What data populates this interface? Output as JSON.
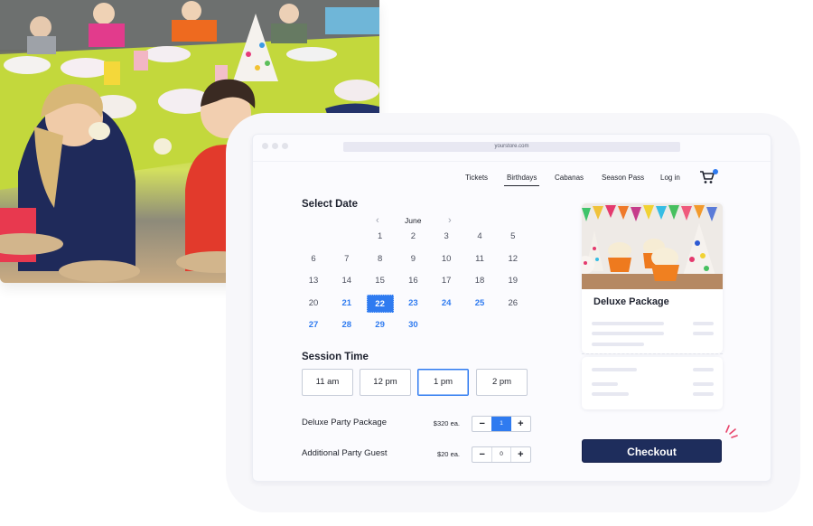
{
  "photo": {
    "alt": "children eating cupcakes at a birthday party table"
  },
  "browser": {
    "url": "yourstore.com",
    "nav": [
      {
        "label": "Tickets",
        "active": false
      },
      {
        "label": "Birthdays",
        "active": true
      },
      {
        "label": "Cabanas",
        "active": false
      },
      {
        "label": "Season Pass",
        "active": false
      },
      {
        "label": "Log in",
        "active": false
      }
    ],
    "cart_icon": "shopping-cart-icon",
    "cart_badge_color": "#2f7bf0"
  },
  "calendar": {
    "title": "Select Date",
    "month": "June",
    "prev_icon": "chevron-left-icon",
    "next_icon": "chevron-right-icon",
    "selected_day": 22,
    "available_days": [
      21,
      23,
      24,
      25,
      27,
      28,
      29,
      30
    ],
    "weeks": [
      [
        "",
        "",
        "1",
        "2",
        "3",
        "4",
        "5"
      ],
      [
        "6",
        "7",
        "8",
        "9",
        "10",
        "11",
        "12"
      ],
      [
        "13",
        "14",
        "15",
        "16",
        "17",
        "18",
        "19"
      ],
      [
        "20",
        "21",
        "22",
        "23",
        "24",
        "25",
        "26"
      ],
      [
        "27",
        "28",
        "29",
        "30",
        "",
        "",
        ""
      ]
    ]
  },
  "session": {
    "title": "Session Time",
    "times": [
      "11 am",
      "12 pm",
      "1 pm",
      "2 pm"
    ],
    "selected": "1 pm"
  },
  "items": [
    {
      "label": "Deluxe Party Package",
      "price": "$320 ea.",
      "quantity": "1",
      "active": true
    },
    {
      "label": "Additional Party Guest",
      "price": "$20 ea.",
      "quantity": "0",
      "active": false
    }
  ],
  "stepper": {
    "minus": "−",
    "plus": "+"
  },
  "package": {
    "title": "Deluxe Package"
  },
  "checkout": {
    "label": "Checkout"
  },
  "colors": {
    "accent": "#2f7bf0",
    "checkout_bg": "#1e2d5c",
    "spark": "#e8436a"
  }
}
